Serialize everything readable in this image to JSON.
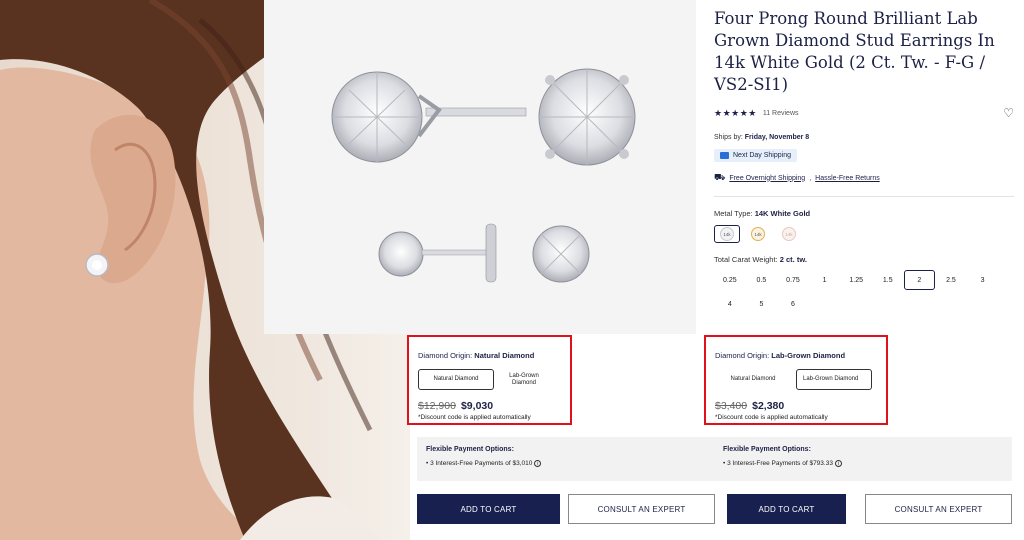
{
  "product": {
    "title": "Four Prong Round Brilliant Lab Grown Diamond Stud Earrings In 14k White Gold (2 Ct. Tw. - F-G / VS2-SI1)",
    "stars": "★★★★★",
    "reviews": "11 Reviews",
    "ships_prefix": "Ships by: ",
    "ships_date": "Friday, November 8",
    "next_day": "Next Day Shipping",
    "free_overnight": "Free Overnight Shipping",
    "separator": ", ",
    "hassle_free": "Hassle-Free Returns",
    "metal_prefix": "Metal Type: ",
    "metal_value": "14K White Gold",
    "metal_swatches": [
      {
        "label": "14k",
        "color": "#f2f2f4",
        "ring": "#c9c9cf"
      },
      {
        "label": "14k",
        "color": "#fbf3e2",
        "ring": "#e0b24d"
      },
      {
        "label": "14k",
        "color": "#fbf1ee",
        "ring": "#e8c8bd"
      }
    ],
    "carat_prefix": "Total Carat Weight: ",
    "carat_value": "2 ct. tw.",
    "carats": [
      "0.25",
      "0.5",
      "0.75",
      "1",
      "1.25",
      "1.5",
      "2",
      "2.5",
      "3",
      "4",
      "5",
      "6"
    ],
    "carat_selected": "2"
  },
  "natural": {
    "label_prefix": "Diamond Origin: ",
    "label_value": "Natural Diamond",
    "btn_natural": "Natural Diamond",
    "btn_lab": "Lab-Grown Diamond",
    "old_price": "$12,900",
    "new_price": "$9,030",
    "discount": "*Discount code is applied automatically",
    "pay_title": "Flexible Payment Options:",
    "pay_line": "• 3 Interest-Free Payments of $3,010",
    "add_to_cart": "ADD TO CART",
    "consult": "CONSULT AN EXPERT"
  },
  "lab": {
    "label_prefix": "Diamond Origin: ",
    "label_value": "Lab-Grown Diamond",
    "btn_natural": "Natural Diamond",
    "btn_lab": "Lab-Grown Diamond",
    "old_price": "$3,400",
    "new_price": "$2,380",
    "discount": "*Discount code is applied automatically",
    "pay_title": "Flexible Payment Options:",
    "pay_line": "• 3 Interest-Free Payments of $793.33",
    "add_to_cart": "ADD TO CART",
    "consult": "CONSULT AN EXPERT"
  },
  "icons": {
    "info": "i",
    "heart": "♡",
    "truck": "⛟"
  }
}
